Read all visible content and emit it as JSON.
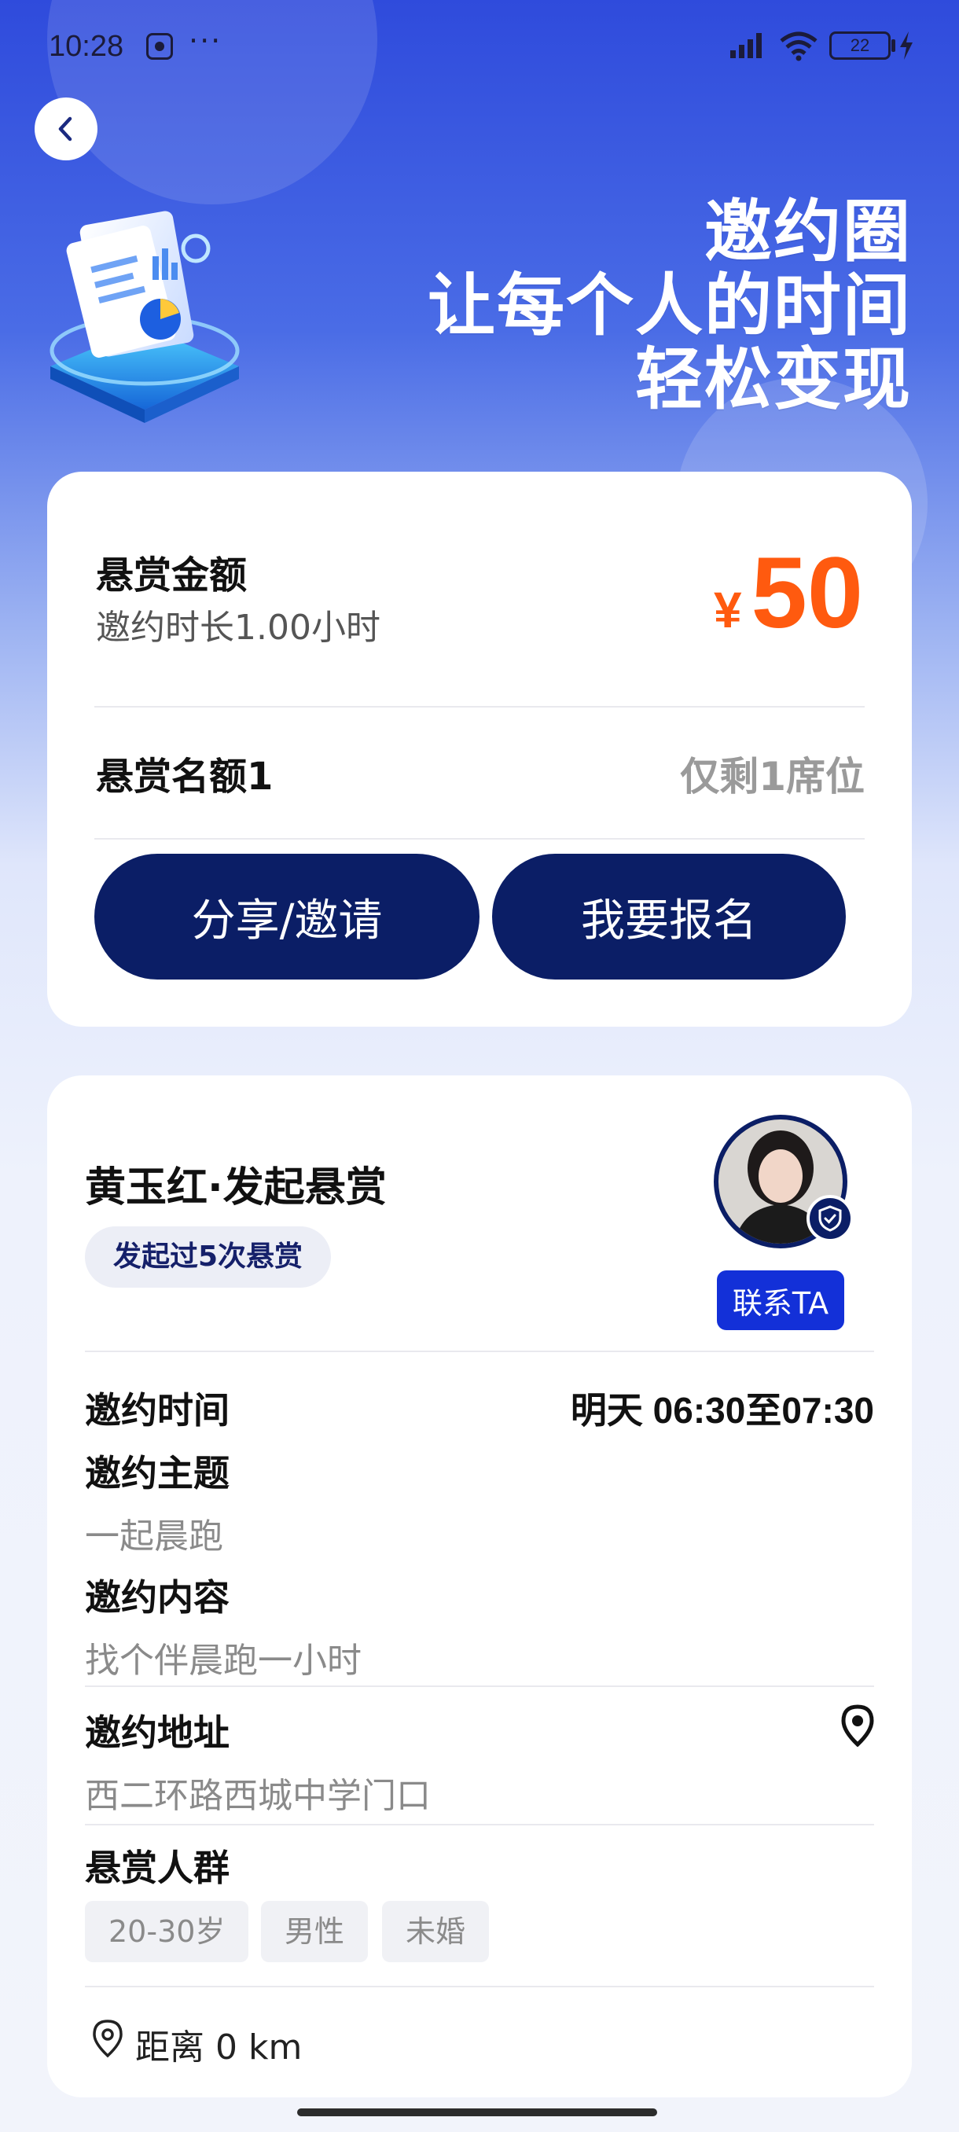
{
  "status_bar": {
    "time": "10:28",
    "dots": "···",
    "battery": "22",
    "icons": [
      "baidu-icon",
      "signal-icon",
      "wifi-icon",
      "battery-icon",
      "charging-bolt-icon"
    ]
  },
  "header": {
    "title_lines": [
      "邀约圈",
      "让每个人的时间",
      "轻松变现"
    ],
    "back_icon": "chevron-left-icon"
  },
  "reward_card": {
    "reward_label": "悬赏金额",
    "duration": "邀约时长1.00小时",
    "currency_symbol": "¥",
    "amount": "50",
    "slots_label": "悬赏名额1",
    "slots_remaining": "仅剩1席位",
    "share_button": "分享/邀请",
    "signup_button": "我要报名"
  },
  "detail_card": {
    "initiator": "黄玉红·发起悬赏",
    "count_badge": "发起过5次悬赏",
    "contact_button": "联系TA",
    "time_label": "邀约时间",
    "time_value": "明天 06:30至07:30",
    "theme_label": "邀约主题",
    "theme_value": "一起晨跑",
    "content_label": "邀约内容",
    "content_value": "找个伴晨跑一小时",
    "address_label": "邀约地址",
    "address_value": "西二环路西城中学门口",
    "audience_label": "悬赏人群",
    "audience_tags": [
      "20-30岁",
      "男性",
      "未婚"
    ],
    "distance": "距离 0 km"
  },
  "colors": {
    "primary_navy": "#0b1e66",
    "accent_orange": "#ff5a0f",
    "contact_blue": "#1330d8",
    "header_blue": "#2f4bdc"
  }
}
